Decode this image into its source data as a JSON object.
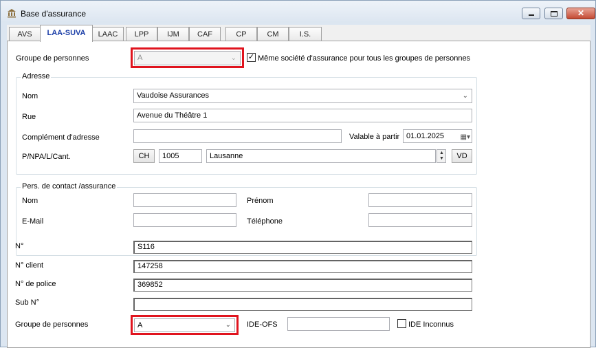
{
  "window": {
    "title": "Base d'assurance",
    "icon": "bank-icon",
    "close_glyph": "✕"
  },
  "tabs": [
    "AVS",
    "LAA-SUVA",
    "LAAC",
    "LPP",
    "IJM",
    "CAF",
    "CP",
    "CM",
    "I.S."
  ],
  "active_tab": "LAA-SUVA",
  "top": {
    "group_label": "Groupe de personnes",
    "group_value": "A",
    "same_company_checked": true,
    "same_company_label": "Même société d'assurance pour tous les groupes de personnes"
  },
  "address": {
    "title": "Adresse",
    "name_label": "Nom",
    "name_value": "Vaudoise Assurances",
    "street_label": "Rue",
    "street_value": "Avenue du Théâtre 1",
    "complement_label": "Complément d'adresse",
    "complement_value": "",
    "valid_from_label": "Valable à partir",
    "valid_from_value": "01.01.2025",
    "npa_label": "P/NPA/L/Cant.",
    "country": "CH",
    "npa": "1005",
    "city": "Lausanne",
    "canton": "VD"
  },
  "contact": {
    "title": "Pers. de contact /assurance",
    "name_label": "Nom",
    "name_value": "",
    "firstname_label": "Prénom",
    "firstname_value": "",
    "email_label": "E-Mail",
    "email_value": "",
    "phone_label": "Téléphone",
    "phone_value": ""
  },
  "numbers": {
    "no_label": "N°",
    "no_value": "S116",
    "client_label": "N° client",
    "client_value": "147258",
    "police_label": "N° de police",
    "police_value": "369852",
    "sub_label": "Sub N°",
    "sub_value": ""
  },
  "bottom": {
    "group_label": "Groupe de personnes",
    "group_value": "A",
    "ide_label": "IDE-OFS",
    "ide_value": "",
    "ide_unknown_checked": false,
    "ide_unknown_label": "IDE Inconnus"
  },
  "colors": {
    "highlight": "#e0141e",
    "active_tab_text": "#1c3fa8"
  }
}
